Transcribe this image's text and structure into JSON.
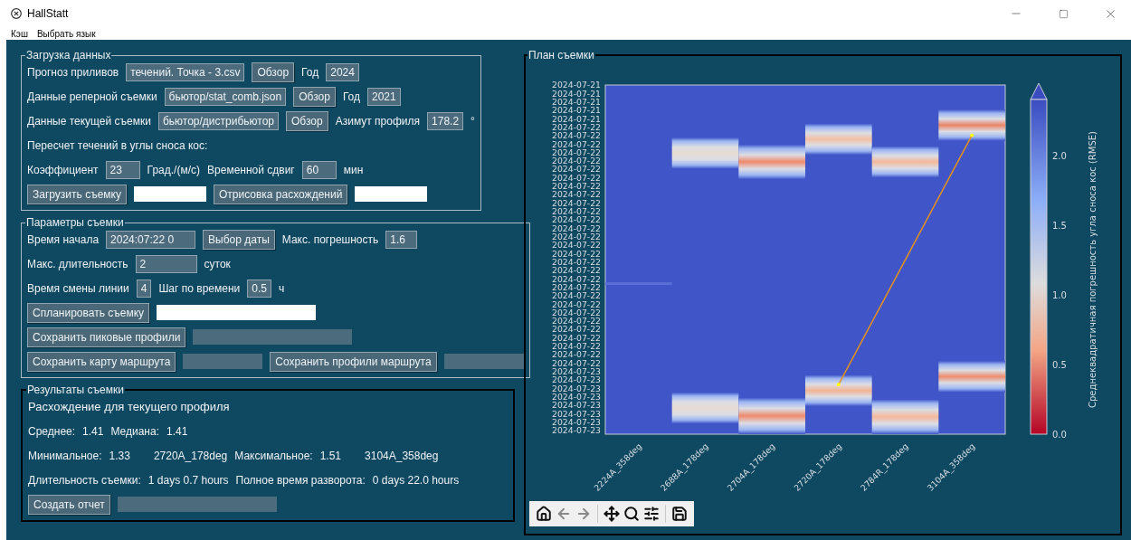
{
  "window": {
    "title": "HallStatt"
  },
  "menu": [
    {
      "label": "Кэш"
    },
    {
      "label": "Выбрать язык"
    }
  ],
  "data_loading": {
    "title": "Загрузка данных",
    "forecast": {
      "label": "Прогноз приливов",
      "file": "течений. Точка - 3.csv",
      "button": "Обзор",
      "year_label": "Год",
      "year": "2024"
    },
    "reference": {
      "label": "Данные реперной съемки",
      "file": "бьютор/stat_comb.json",
      "button": "Обзор",
      "year_label": "Год",
      "year": "2021"
    },
    "current": {
      "label": "Данные текущей съемки",
      "file": "бьютор/дистрибьютор",
      "button": "Обзор",
      "azimuth_label": "Азимут профиля",
      "azimuth": "178.2",
      "unit": "°"
    },
    "conversion_heading": "Пересчет течений в углы сноса кос:",
    "coefficient_label": "Коэффициент",
    "coefficient": "23",
    "coefficient_unit": "Град./(м/с)",
    "shift_label": "Временной сдвиг",
    "shift": "60",
    "shift_unit": "мин",
    "load_button": "Загрузить съемку",
    "load_status": {
      "disabled": false
    },
    "draw_button": "Отрисовка расхождений",
    "draw_status": {
      "disabled": false
    }
  },
  "survey_params": {
    "title": "Параметры съемки",
    "start_label": "Время начала",
    "start": "2024:07:22 0",
    "date_button": "Выбор даты",
    "max_error_label": "Макс. погрешность",
    "max_error": "1.6",
    "max_duration_label": "Макс. длительность",
    "max_duration": "2",
    "duration_unit": "суток",
    "line_change_label": "Время смены линии",
    "line_change": "4",
    "step_label": "Шаг по времени",
    "step": "0.5",
    "step_unit": "ч",
    "plan_button": "Спланировать съемку",
    "plan_status": {
      "disabled": false
    },
    "peaks_button": "Сохранить пиковые профили",
    "peaks_status": {
      "disabled": true
    },
    "map_button": "Сохранить карту маршрута",
    "map_status": {
      "disabled": true
    },
    "profiles_button": "Сохранить профили маршрута",
    "profiles_status": {
      "disabled": true
    }
  },
  "results": {
    "title": "Результаты съемки",
    "heading": "Расхождение для текущего профиля",
    "mean_label": "Среднее:",
    "mean": "1.41",
    "median_label": "Медиана:",
    "median": "1.41",
    "min_label": "Минимальное:",
    "min": "1.33",
    "min_profile": "2720A_178deg",
    "max_label": "Максимальное:",
    "max": "1.51",
    "max_profile": "3104A_358deg",
    "duration_label": "Длительность съемки:",
    "duration": "1 days 0.7 hours",
    "turn_label": "Полное время разворота:",
    "turn": "0 days 22.0 hours",
    "report_button": "Создать отчет",
    "report_status": {
      "disabled": true
    }
  },
  "plan": {
    "title": "План съемки",
    "y_ticks": [
      "2024-07-21",
      "2024-07-21",
      "2024-07-21",
      "2024-07-21",
      "2024-07-21",
      "2024-07-22",
      "2024-07-22",
      "2024-07-22",
      "2024-07-22",
      "2024-07-22",
      "2024-07-22",
      "2024-07-22",
      "2024-07-22",
      "2024-07-22",
      "2024-07-22",
      "2024-07-22",
      "2024-07-22",
      "2024-07-22",
      "2024-07-22",
      "2024-07-22",
      "2024-07-22",
      "2024-07-22",
      "2024-07-22",
      "2024-07-22",
      "2024-07-22",
      "2024-07-22",
      "2024-07-22",
      "2024-07-22",
      "2024-07-22",
      "2024-07-22",
      "2024-07-22",
      "2024-07-22",
      "2024-07-22",
      "2024-07-22",
      "2024-07-23",
      "2024-07-23",
      "2024-07-23",
      "2024-07-23",
      "2024-07-23",
      "2024-07-23",
      "2024-07-23",
      "2024-07-23"
    ],
    "x_ticks": [
      "2224A_358deg",
      "2688A_178deg",
      "2704A_178deg",
      "2720A_178deg",
      "2784R_178deg",
      "3104A_358deg"
    ],
    "colorbar_label": "Среднеквадратичная погрешность угла сноса кос (RMSE)",
    "colorbar_ticks": [
      "2.0",
      "1.5",
      "1.0",
      "0.5",
      "0.0"
    ],
    "toolbar": [
      {
        "kind": "home",
        "disabled": false
      },
      {
        "kind": "back",
        "disabled": true
      },
      {
        "kind": "forward",
        "disabled": true
      },
      {
        "kind": "pan",
        "disabled": false
      },
      {
        "kind": "zoom",
        "disabled": false
      },
      {
        "kind": "configure",
        "disabled": false
      },
      {
        "kind": "save",
        "disabled": false
      }
    ]
  }
}
